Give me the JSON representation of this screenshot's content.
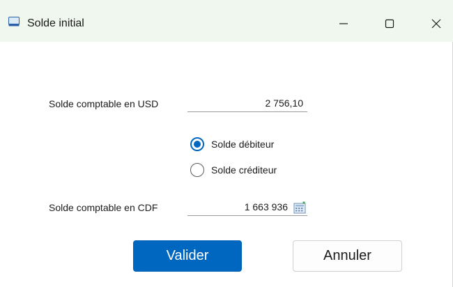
{
  "window": {
    "title": "Solde initial",
    "icon": "window-app-icon",
    "controls": {
      "minimize_icon": "minimize-icon",
      "maximize_icon": "maximize-icon",
      "close_icon": "close-icon"
    }
  },
  "form": {
    "usd_label": "Solde comptable en USD",
    "usd_value": "2 756,10",
    "balance_type": {
      "options": [
        {
          "label": "Solde débiteur",
          "checked": true
        },
        {
          "label": "Solde créditeur",
          "checked": false
        }
      ]
    },
    "cdf_label": "Solde comptable en CDF",
    "cdf_value": "1 663 936",
    "cdf_icon": "calculator-icon"
  },
  "buttons": {
    "validate_label": "Valider",
    "cancel_label": "Annuler"
  },
  "colors": {
    "titlebar_bg": "#f0f7ee",
    "accent": "#0067c0",
    "text": "#1a1a1a"
  }
}
